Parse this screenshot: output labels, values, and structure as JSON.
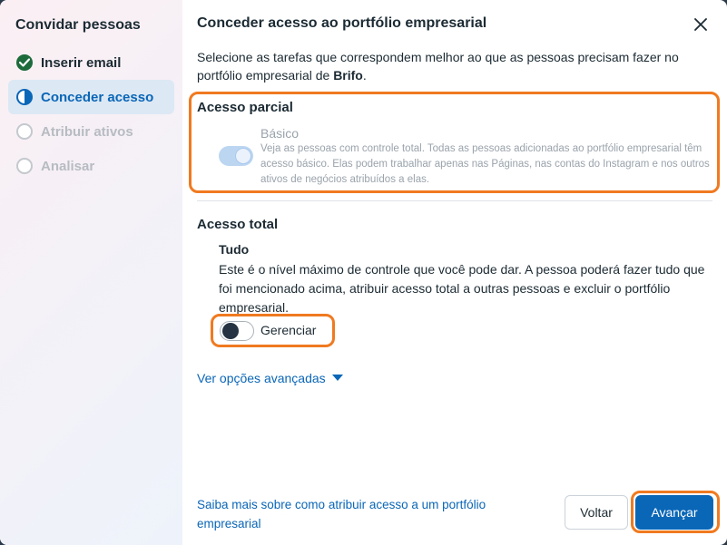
{
  "sidebar": {
    "title": "Convidar pessoas",
    "steps": [
      {
        "label": "Inserir email",
        "state": "done"
      },
      {
        "label": "Conceder acesso",
        "state": "active"
      },
      {
        "label": "Atribuir ativos",
        "state": "pending"
      },
      {
        "label": "Analisar",
        "state": "pending"
      }
    ]
  },
  "header": {
    "title": "Conceder acesso ao portfólio empresarial",
    "close_icon": "close-icon"
  },
  "intro": {
    "text_before": "Selecione as tarefas que correspondem melhor ao que as pessoas precisam fazer no portfólio empresarial de ",
    "business_name": "Brifo",
    "text_after": "."
  },
  "partial_access": {
    "title": "Acesso parcial",
    "basic": {
      "label": "Básico",
      "description": "Veja as pessoas com controle total. Todas as pessoas adicionadas ao portfólio empresarial têm acesso básico. Elas podem trabalhar apenas nas Páginas, nas contas do Instagram e nos outros ativos de negócios atribuídos a elas.",
      "enabled": true,
      "disabled": true
    }
  },
  "full_access": {
    "title": "Acesso total",
    "option_title": "Tudo",
    "option_description": "Este é o nível máximo de controle que você pode dar. A pessoa poderá fazer tudo que foi mencionado acima, atribuir acesso total a outras pessoas e excluir o portfólio empresarial.",
    "manage": {
      "label": "Gerenciar",
      "enabled": false
    }
  },
  "advanced_link": "Ver opções avançadas",
  "footer": {
    "help_link": "Saiba mais sobre como atribuir acesso a um portfólio empresarial",
    "back_label": "Voltar",
    "next_label": "Avançar"
  },
  "colors": {
    "accent": "#0a66b7",
    "highlight": "#f07a1f",
    "done": "#1d6b3a"
  }
}
